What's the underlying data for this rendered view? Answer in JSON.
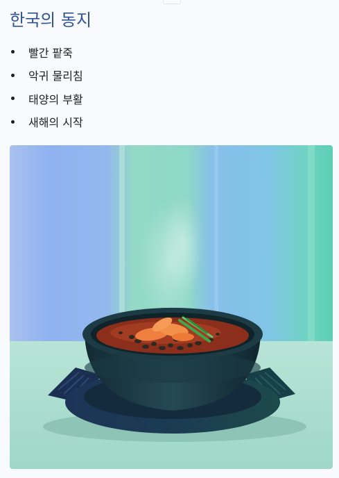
{
  "page": {
    "title": "한국의 동지",
    "items": [
      {
        "label": "빨간 팥죽"
      },
      {
        "label": "악귀 물리침"
      },
      {
        "label": "태양의 부활"
      },
      {
        "label": "새해의 시작"
      }
    ]
  },
  "photo": {
    "subject": "steaming red bean porridge in a dark stone pot",
    "colors": {
      "background_blue": "#8fb6ef",
      "background_teal": "#7fdcc4",
      "table": "#a9dccb",
      "pot": "#1e3c45",
      "stew": "#8a2a1a",
      "carrot": "#f07a3a",
      "scallion": "#4bbf5a"
    }
  }
}
